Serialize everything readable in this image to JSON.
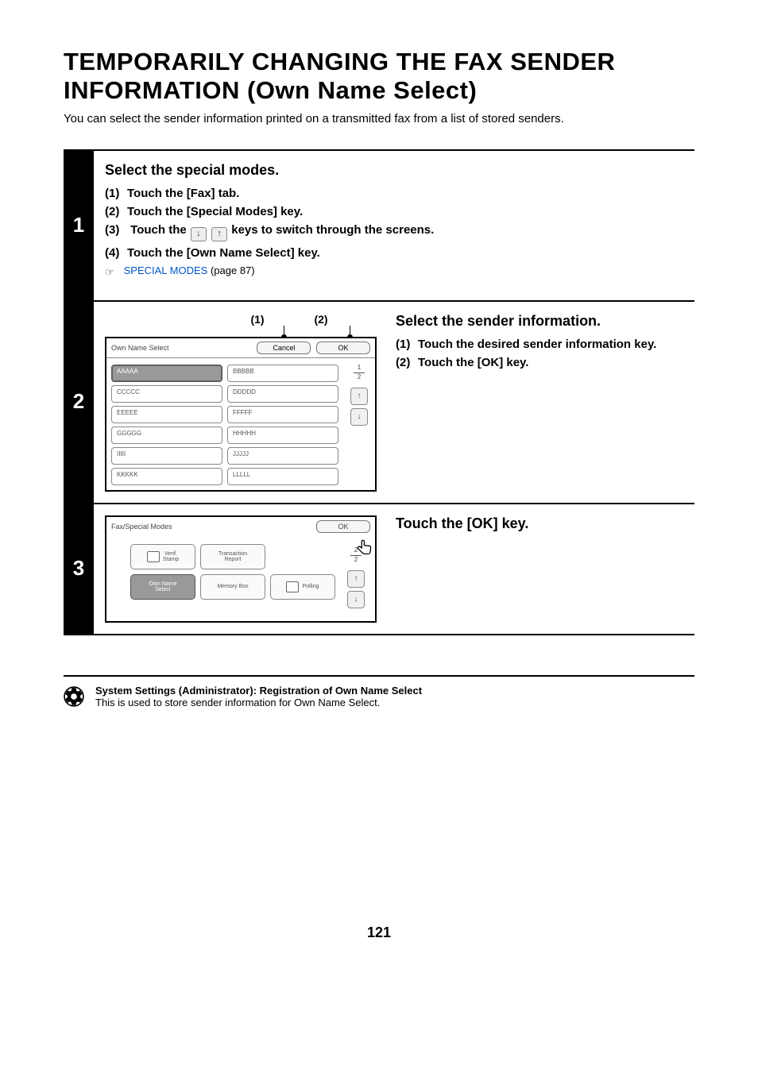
{
  "page_title_l1": "TEMPORARILY CHANGING THE FAX SENDER",
  "page_title_l2": "INFORMATION (Own Name Select)",
  "intro": "You can select the sender information printed on a transmitted fax from a list of stored senders.",
  "step1": {
    "num": "1",
    "title": "Select the special modes.",
    "s1": "Touch the [Fax] tab.",
    "s2": "Touch the [Special Modes] key.",
    "s3a": "Touch the ",
    "s3b": " keys to switch through the screens.",
    "s4": "Touch the [Own Name Select] key.",
    "link_text": "SPECIAL MODES",
    "link_page": " (page 87)"
  },
  "step2": {
    "num": "2",
    "title": "Select the sender information.",
    "s1": "Touch the desired sender information key.",
    "s2": "Touch the [OK] key.",
    "callout1": "(1)",
    "callout2": "(2)",
    "screen": {
      "title": "Own Name Select",
      "cancel": "Cancel",
      "ok": "OK",
      "items": [
        "AAAAA",
        "BBBBB",
        "CCCCC",
        "DDDDD",
        "EEEEE",
        "FFFFF",
        "GGGGG",
        "HHHHH",
        "IIIII",
        "JJJJJ",
        "KKKKK",
        "LLLLL"
      ],
      "page_cur": "1",
      "page_tot": "2"
    }
  },
  "step3": {
    "num": "3",
    "title": "Touch the [OK] key.",
    "screen": {
      "title": "Fax/Special Modes",
      "ok": "OK",
      "btns": {
        "verif": "Verif.\nStamp",
        "trans": "Transaction\nReport",
        "own": "Own Name\nSelect",
        "mbox": "Memory Box",
        "poll": "Polling"
      },
      "page_cur": "2",
      "page_tot": "2"
    }
  },
  "admin": {
    "title": "System Settings (Administrator): Registration of Own Name Select",
    "text": "This is used to store sender information for Own Name Select."
  },
  "page_number": "121",
  "sub_labels": {
    "n1": "(1)",
    "n2": "(2)",
    "n3": "(3)",
    "n4": "(4)"
  }
}
